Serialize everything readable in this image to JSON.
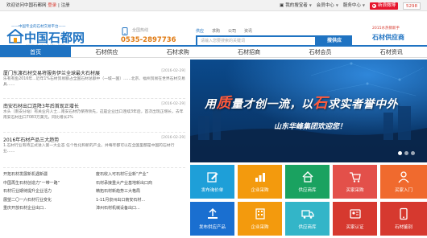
{
  "topbar": {
    "welcome": "欢迎访问中国石都网",
    "login": "登录",
    "sep": "|",
    "register": "注册",
    "links": [
      "我的搜宝者",
      "会员中心",
      "服务中心"
    ],
    "weibo": "新浪微博",
    "counter": "5298"
  },
  "logo": {
    "slogan": "——中国专业的石材交易平台——",
    "name": "中国石都网",
    "url": "WWW.CHINASHIDU.COM"
  },
  "hotline": {
    "label": "全国热线",
    "number": "0535-2897736"
  },
  "search": {
    "tabs": [
      "供应",
      "求购",
      "公司",
      "资讯"
    ],
    "placeholder": "请输入您要搜索的关键词",
    "button": "搜供应",
    "hot": "热门搜索：花岗岩 大理石 石雕 墓碑"
  },
  "header_right": {
    "line1": "2015水热销新手",
    "line2": "石材供应商"
  },
  "nav": {
    "items": [
      "首页",
      "石材供应",
      "石材求购",
      "石材招商",
      "石材会员",
      "石材资讯"
    ],
    "active_index": 0
  },
  "news": {
    "items": [
      {
        "title": "厦门东渡石材交易将服务伊兰全球最大石材展",
        "date": "[2016-02-29]",
        "desc": "乐有有鱼2016年...近年1%石材贸易额占全国石材总额中（一城一国）……北京、福州贸易在世界石材交易具……"
      },
      {
        "title": "南安石材出口连降3年后首现正增长",
        "date": "[2016-02-29]",
        "desc": "水头（南安分站）有关业内人士...南安石材仍保持领先，这是企业出口连续3年后，首次出现正增长，去年南安石材出口7083万美元。同比增长2%"
      },
      {
        "title": "2016年石材产品三大趋势",
        "date": "[2016-02-29]",
        "desc": "1.石材行业有待正式进入第一大业态 任个性化和新的产业。并每年都可以在全国里都是中国的石材行业……"
      }
    ],
    "list": [
      [
        "开拓石材发展新机遇新疆",
        "废石收入可石材行业新“产业”"
      ],
      [
        "中国再生石材创造力“一带一路”",
        "石材承接重大产业基地新出口商"
      ],
      [
        "石材行业期待提升企业活力",
        "精拓石材新趋势三大格局"
      ],
      [
        "展望二〇一六石材行业变化",
        "1-11月泉州出口南安石材..."
      ],
      [
        "重庆开放石材企业出口..",
        "漳州石材机械设备出口..."
      ]
    ]
  },
  "banner": {
    "slogan_a": "用",
    "slogan_b": "质",
    "slogan_c": "量才创一流，以",
    "slogan_d": "石",
    "slogan_e": "求实者誉中外",
    "company": "山东华峰集团欢迎您！"
  },
  "tiles": [
    {
      "label": "发布询价单",
      "color": "#1e9fd8",
      "icon": "edit-icon"
    },
    {
      "label": "企业采购",
      "color": "#f39a0d",
      "icon": "chart-icon"
    },
    {
      "label": "供应商库",
      "color": "#1aa260",
      "icon": "home-icon"
    },
    {
      "label": "买家采购",
      "color": "#e3504a",
      "icon": "cart-icon"
    },
    {
      "label": "买家入门",
      "color": "#f06a2e",
      "icon": "person-icon"
    },
    {
      "label": "发布供应产品",
      "color": "#1a6fd0",
      "icon": "upload-icon"
    },
    {
      "label": "企业采购",
      "color": "#f39a0d",
      "icon": "building-icon"
    },
    {
      "label": "供应商库",
      "color": "#33b5c8",
      "icon": "truck-icon"
    },
    {
      "label": "买家认证",
      "color": "#d6392f",
      "icon": "badge-icon"
    },
    {
      "label": "石材鉴别",
      "color": "#d6392f",
      "icon": "phone-icon"
    }
  ]
}
